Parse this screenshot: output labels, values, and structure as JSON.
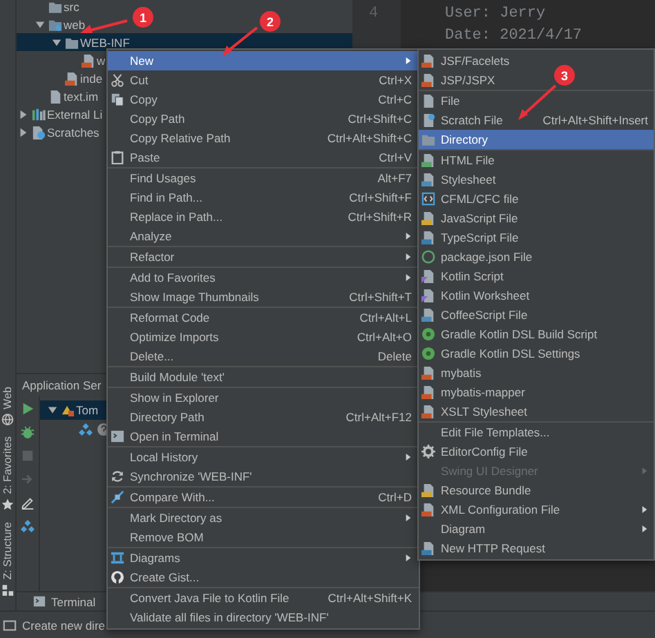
{
  "project_tree": {
    "module_children": [
      {
        "label": "src",
        "kind": "folder",
        "selected": false
      },
      {
        "label": "web",
        "kind": "webfolder",
        "expanded": true,
        "selected": false,
        "children": [
          {
            "label": "WEB-INF",
            "kind": "folder",
            "expanded": true,
            "selected": true,
            "children": [
              {
                "label": "w",
                "kind": "xmlfile",
                "selected": false
              }
            ]
          },
          {
            "label": "inde",
            "kind": "xmlfile",
            "selected": false
          }
        ]
      },
      {
        "label": "text.im",
        "kind": "file",
        "selected": false
      }
    ],
    "roots": [
      {
        "label": "External Li",
        "kind": "library",
        "expanded": false,
        "selected": false
      },
      {
        "label": "Scratches",
        "kind": "scratch",
        "expanded": false,
        "selected": false
      }
    ]
  },
  "tool_strip": [
    {
      "label": "Web",
      "kind": "globe"
    },
    {
      "label": "2: Favorites",
      "kind": "star"
    },
    {
      "label": "Z: Structure",
      "kind": "structure"
    }
  ],
  "services": {
    "title": "Application Ser",
    "tree": [
      {
        "label": "Tom",
        "expanded": true,
        "selected": true
      }
    ]
  },
  "editor": {
    "line_numbers": [
      "4"
    ],
    "lines": [
      "User: Jerry",
      "Date: 2021/4/17"
    ]
  },
  "bottom_tabs": [
    {
      "label": "Terminal"
    }
  ],
  "status_bar": {
    "text": "Create new dire"
  },
  "context_menu": [
    {
      "label": "New",
      "kind": "plain",
      "submenu": true,
      "selected": true
    },
    {
      "label": "Cut",
      "kind": "cut",
      "shortcut": "Ctrl+X",
      "submenu": false,
      "selected": false
    },
    {
      "label": "Copy",
      "kind": "copy",
      "shortcut": "Ctrl+C",
      "submenu": false,
      "selected": false
    },
    {
      "label": "Copy Path",
      "kind": "plain",
      "shortcut": "Ctrl+Shift+C",
      "submenu": false,
      "selected": false
    },
    {
      "label": "Copy Relative Path",
      "kind": "plain",
      "shortcut": "Ctrl+Alt+Shift+C",
      "submenu": false,
      "selected": false
    },
    {
      "label": "Paste",
      "kind": "paste",
      "shortcut": "Ctrl+V",
      "submenu": false,
      "selected": false
    },
    {
      "kind": "separator"
    },
    {
      "label": "Find Usages",
      "kind": "plain",
      "shortcut": "Alt+F7",
      "submenu": false,
      "selected": false
    },
    {
      "label": "Find in Path...",
      "kind": "plain",
      "shortcut": "Ctrl+Shift+F",
      "submenu": false,
      "selected": false
    },
    {
      "label": "Replace in Path...",
      "kind": "plain",
      "shortcut": "Ctrl+Shift+R",
      "submenu": false,
      "selected": false
    },
    {
      "label": "Analyze",
      "kind": "plain",
      "submenu": true,
      "selected": false
    },
    {
      "kind": "separator"
    },
    {
      "label": "Refactor",
      "kind": "plain",
      "submenu": true,
      "selected": false
    },
    {
      "kind": "separator"
    },
    {
      "label": "Add to Favorites",
      "kind": "plain",
      "submenu": true,
      "selected": false
    },
    {
      "label": "Show Image Thumbnails",
      "kind": "plain",
      "shortcut": "Ctrl+Shift+T",
      "submenu": false,
      "selected": false
    },
    {
      "kind": "separator"
    },
    {
      "label": "Reformat Code",
      "kind": "plain",
      "shortcut": "Ctrl+Alt+L",
      "submenu": false,
      "selected": false
    },
    {
      "label": "Optimize Imports",
      "kind": "plain",
      "shortcut": "Ctrl+Alt+O",
      "submenu": false,
      "selected": false
    },
    {
      "label": "Delete...",
      "kind": "plain",
      "shortcut": "Delete",
      "submenu": false,
      "selected": false
    },
    {
      "kind": "separator"
    },
    {
      "label": "Build Module 'text'",
      "kind": "plain",
      "submenu": false,
      "selected": false
    },
    {
      "kind": "separator"
    },
    {
      "label": "Show in Explorer",
      "kind": "plain",
      "submenu": false,
      "selected": false
    },
    {
      "label": "Directory Path",
      "kind": "plain",
      "shortcut": "Ctrl+Alt+F12",
      "submenu": false,
      "selected": false
    },
    {
      "label": "Open in Terminal",
      "kind": "terminal",
      "submenu": false,
      "selected": false
    },
    {
      "kind": "separator"
    },
    {
      "label": "Local History",
      "kind": "plain",
      "submenu": true,
      "selected": false
    },
    {
      "label": "Synchronize 'WEB-INF'",
      "kind": "sync",
      "submenu": false,
      "selected": false
    },
    {
      "kind": "separator"
    },
    {
      "label": "Compare With...",
      "kind": "compare",
      "shortcut": "Ctrl+D",
      "submenu": false,
      "selected": false
    },
    {
      "kind": "separator"
    },
    {
      "label": "Mark Directory as",
      "kind": "plain",
      "submenu": true,
      "selected": false
    },
    {
      "label": "Remove BOM",
      "kind": "plain",
      "submenu": false,
      "selected": false
    },
    {
      "kind": "separator"
    },
    {
      "label": "Diagrams",
      "kind": "diagrams",
      "submenu": true,
      "selected": false
    },
    {
      "label": "Create Gist...",
      "kind": "gist",
      "submenu": false,
      "selected": false
    },
    {
      "kind": "separator"
    },
    {
      "label": "Convert Java File to Kotlin File",
      "kind": "plain",
      "shortcut": "Ctrl+Alt+Shift+K",
      "submenu": false,
      "selected": false
    },
    {
      "label": "Validate all files in directory 'WEB-INF'",
      "kind": "plain",
      "submenu": false,
      "selected": false
    }
  ],
  "new_submenu": [
    {
      "label": "JSF/Facelets",
      "kind": "jsf",
      "submenu": false,
      "selected": false,
      "disabled": false
    },
    {
      "label": "JSP/JSPX",
      "kind": "jsf",
      "submenu": false,
      "selected": false,
      "disabled": false
    },
    {
      "kind": "separator"
    },
    {
      "label": "File",
      "kind": "file",
      "submenu": false,
      "selected": false,
      "disabled": false
    },
    {
      "label": "Scratch File",
      "kind": "scratch",
      "shortcut": "Ctrl+Alt+Shift+Insert",
      "submenu": false,
      "selected": false,
      "disabled": false
    },
    {
      "label": "Directory",
      "kind": "folder",
      "submenu": false,
      "selected": true,
      "disabled": false
    },
    {
      "kind": "separator"
    },
    {
      "label": "HTML File",
      "kind": "html",
      "submenu": false,
      "selected": false,
      "disabled": false
    },
    {
      "label": "Stylesheet",
      "kind": "css",
      "submenu": false,
      "selected": false,
      "disabled": false
    },
    {
      "label": "CFML/CFC file",
      "kind": "cfml",
      "submenu": false,
      "selected": false,
      "disabled": false
    },
    {
      "label": "JavaScript File",
      "kind": "js",
      "submenu": false,
      "selected": false,
      "disabled": false
    },
    {
      "label": "TypeScript File",
      "kind": "ts",
      "submenu": false,
      "selected": false,
      "disabled": false
    },
    {
      "label": "package.json File",
      "kind": "json",
      "submenu": false,
      "selected": false,
      "disabled": false
    },
    {
      "label": "Kotlin Script",
      "kind": "kotlin",
      "submenu": false,
      "selected": false,
      "disabled": false
    },
    {
      "label": "Kotlin Worksheet",
      "kind": "kotlin",
      "submenu": false,
      "selected": false,
      "disabled": false
    },
    {
      "label": "CoffeeScript File",
      "kind": "coffee",
      "submenu": false,
      "selected": false,
      "disabled": false
    },
    {
      "label": "Gradle Kotlin DSL Build Script",
      "kind": "gradle",
      "submenu": false,
      "selected": false,
      "disabled": false
    },
    {
      "label": "Gradle Kotlin DSL Settings",
      "kind": "gradle",
      "submenu": false,
      "selected": false,
      "disabled": false
    },
    {
      "label": "mybatis",
      "kind": "xml",
      "submenu": false,
      "selected": false,
      "disabled": false
    },
    {
      "label": "mybatis-mapper",
      "kind": "xml",
      "submenu": false,
      "selected": false,
      "disabled": false
    },
    {
      "label": "XSLT Stylesheet",
      "kind": "xml",
      "submenu": false,
      "selected": false,
      "disabled": false
    },
    {
      "kind": "separator"
    },
    {
      "label": "Edit File Templates...",
      "kind": "plain",
      "submenu": false,
      "selected": false,
      "disabled": false
    },
    {
      "label": "EditorConfig File",
      "kind": "config",
      "submenu": false,
      "selected": false,
      "disabled": false
    },
    {
      "label": "Swing UI Designer",
      "kind": "plain",
      "submenu": true,
      "selected": false,
      "disabled": true
    },
    {
      "label": "Resource Bundle",
      "kind": "bundle",
      "submenu": false,
      "selected": false,
      "disabled": false
    },
    {
      "label": "XML Configuration File",
      "kind": "xml",
      "submenu": true,
      "selected": false,
      "disabled": false
    },
    {
      "label": "Diagram",
      "kind": "plain",
      "submenu": true,
      "selected": false,
      "disabled": false
    },
    {
      "label": "New HTTP Request",
      "kind": "http",
      "submenu": false,
      "selected": false,
      "disabled": false
    }
  ],
  "annotations": [
    {
      "label": "1"
    },
    {
      "label": "2"
    },
    {
      "label": "3"
    }
  ]
}
